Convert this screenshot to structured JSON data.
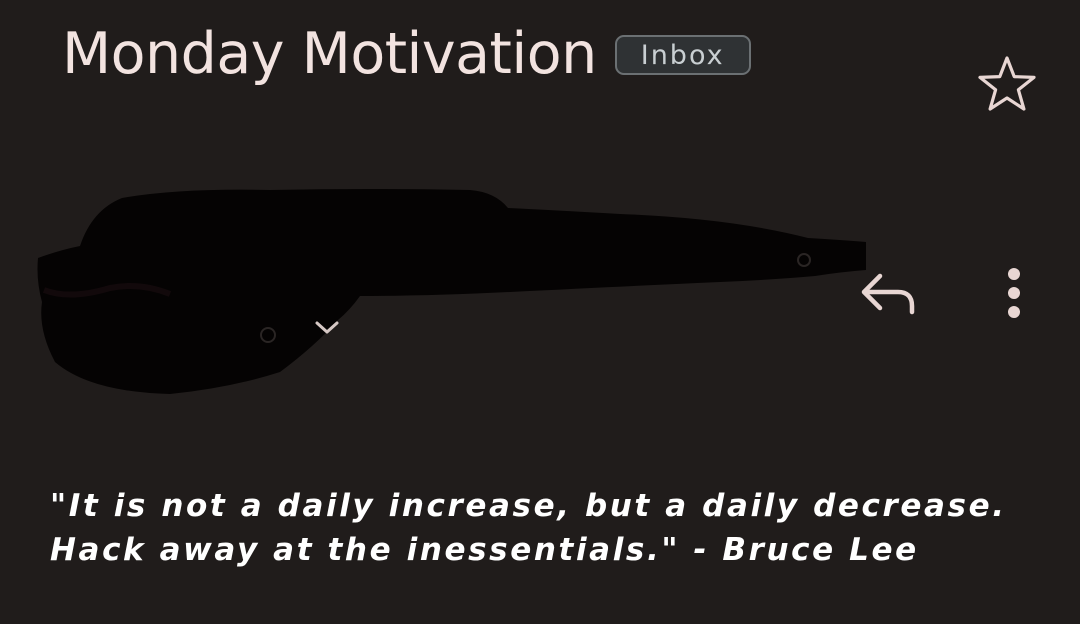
{
  "email": {
    "subject": "Monday Motivation",
    "label": "Inbox",
    "body": "\"It is not a daily increase, but a daily decrease. Hack away at the inessentials.\" - Bruce Lee"
  },
  "icons": {
    "star": "star-outline-icon",
    "reply": "reply-icon",
    "more": "more-vert-icon",
    "expand": "chevron-down-icon"
  },
  "colors": {
    "background": "#201c1b",
    "text_primary": "#f2e3e0",
    "chip_background": "#2f3234",
    "chip_border": "#6b7073",
    "icon": "#e8d6d3"
  }
}
